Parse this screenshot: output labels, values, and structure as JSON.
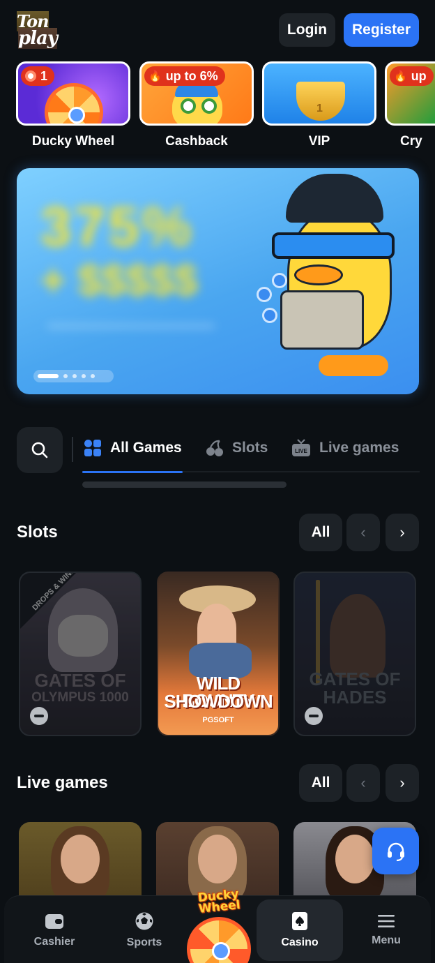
{
  "header": {
    "logo_line1": "Ton",
    "logo_line2": "play",
    "login_label": "Login",
    "register_label": "Register"
  },
  "promos": [
    {
      "label": "Ducky Wheel",
      "badge": "1",
      "icon": "wheel"
    },
    {
      "label": "Cashback",
      "badge": "up to 6%",
      "icon": "duck"
    },
    {
      "label": "VIP",
      "badge": "",
      "icon": "trophy",
      "trophy_number": "1"
    },
    {
      "label": "Cry",
      "badge": "up",
      "icon": "crypto"
    }
  ],
  "banner": {
    "slides": 5,
    "active_slide": 1,
    "colors": {
      "bg_from": "#7fd0ff",
      "bg_to": "#3b8ff0"
    }
  },
  "tabs": {
    "items": [
      {
        "label": "All Games",
        "icon": "grid-icon",
        "active": true
      },
      {
        "label": "Slots",
        "icon": "cherries-icon",
        "active": false
      },
      {
        "label": "Live games",
        "icon": "live-tv-icon",
        "active": false
      }
    ]
  },
  "slots": {
    "title": "Slots",
    "all_label": "All",
    "games": [
      {
        "title_line1": "GATES OF",
        "title_line2": "OLYMPUS 1000",
        "badge": "DROPS & WINS",
        "unavailable": true
      },
      {
        "title_line1": "WILD BOUNTY",
        "title_line2": "SHOWDOWN",
        "provider": "PGSOFT",
        "unavailable": false
      },
      {
        "title_line1": "GATES OF",
        "title_line2": "HADES",
        "unavailable": true
      }
    ]
  },
  "live_games": {
    "title": "Live games",
    "all_label": "All",
    "count_visible": 3
  },
  "bottom_nav": {
    "items": [
      {
        "label": "Cashier",
        "icon": "wallet-icon"
      },
      {
        "label": "Sports",
        "icon": "soccer-ball-icon"
      },
      {
        "label": "Casino",
        "icon": "card-spade-icon",
        "active": true
      },
      {
        "label": "Menu",
        "icon": "hamburger-icon"
      }
    ],
    "center_label_line1": "Ducky",
    "center_label_line2": "Wheel"
  },
  "colors": {
    "accent": "#2b73f5",
    "background": "#0c1014",
    "surface": "#1d2227",
    "badge_red": "#e0321c"
  }
}
